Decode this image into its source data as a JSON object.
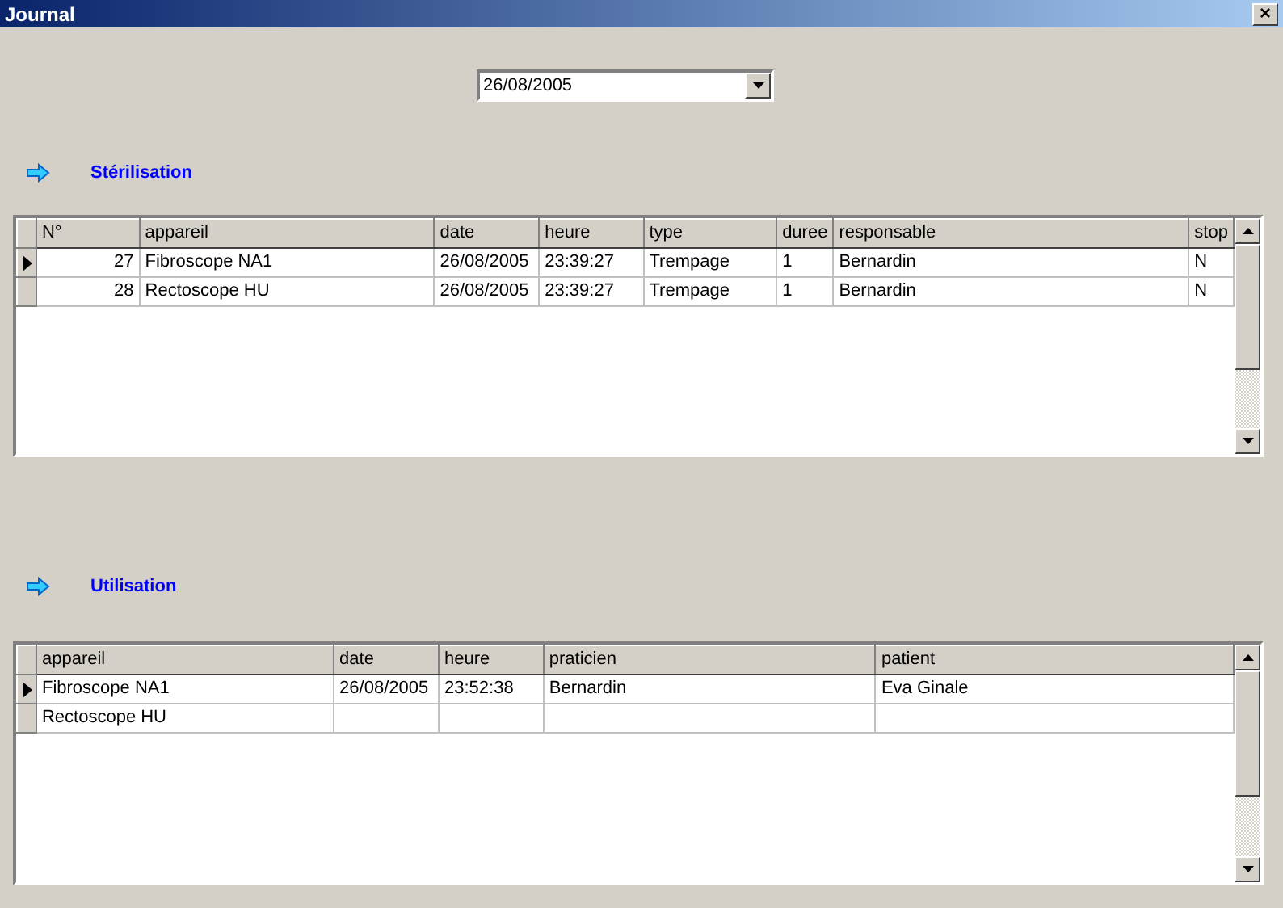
{
  "window": {
    "title": "Journal",
    "close": "×"
  },
  "date_picker": {
    "value": "26/08/2005"
  },
  "sections": [
    {
      "title": "Stérilisation",
      "columns": [
        "N°",
        "appareil",
        "date",
        "heure",
        "type",
        "duree",
        "responsable",
        "stop"
      ],
      "rows": [
        {
          "selected": true,
          "cells": [
            "27",
            "Fibroscope NA1",
            "26/08/2005",
            "23:39:27",
            "Trempage",
            "1",
            "Bernardin",
            "N"
          ]
        },
        {
          "selected": false,
          "cells": [
            "28",
            "Rectoscope HU",
            "26/08/2005",
            "23:39:27",
            "Trempage",
            "1",
            "Bernardin",
            "N"
          ]
        }
      ]
    },
    {
      "title": "Utilisation",
      "columns": [
        "appareil",
        "date",
        "heure",
        "praticien",
        "patient"
      ],
      "rows": [
        {
          "selected": true,
          "cells": [
            "Fibroscope NA1",
            "26/08/2005",
            "23:52:38",
            "Bernardin",
            "Eva Ginale"
          ]
        },
        {
          "selected": false,
          "cells": [
            "Rectoscope HU",
            null,
            null,
            null,
            null
          ]
        }
      ]
    }
  ]
}
